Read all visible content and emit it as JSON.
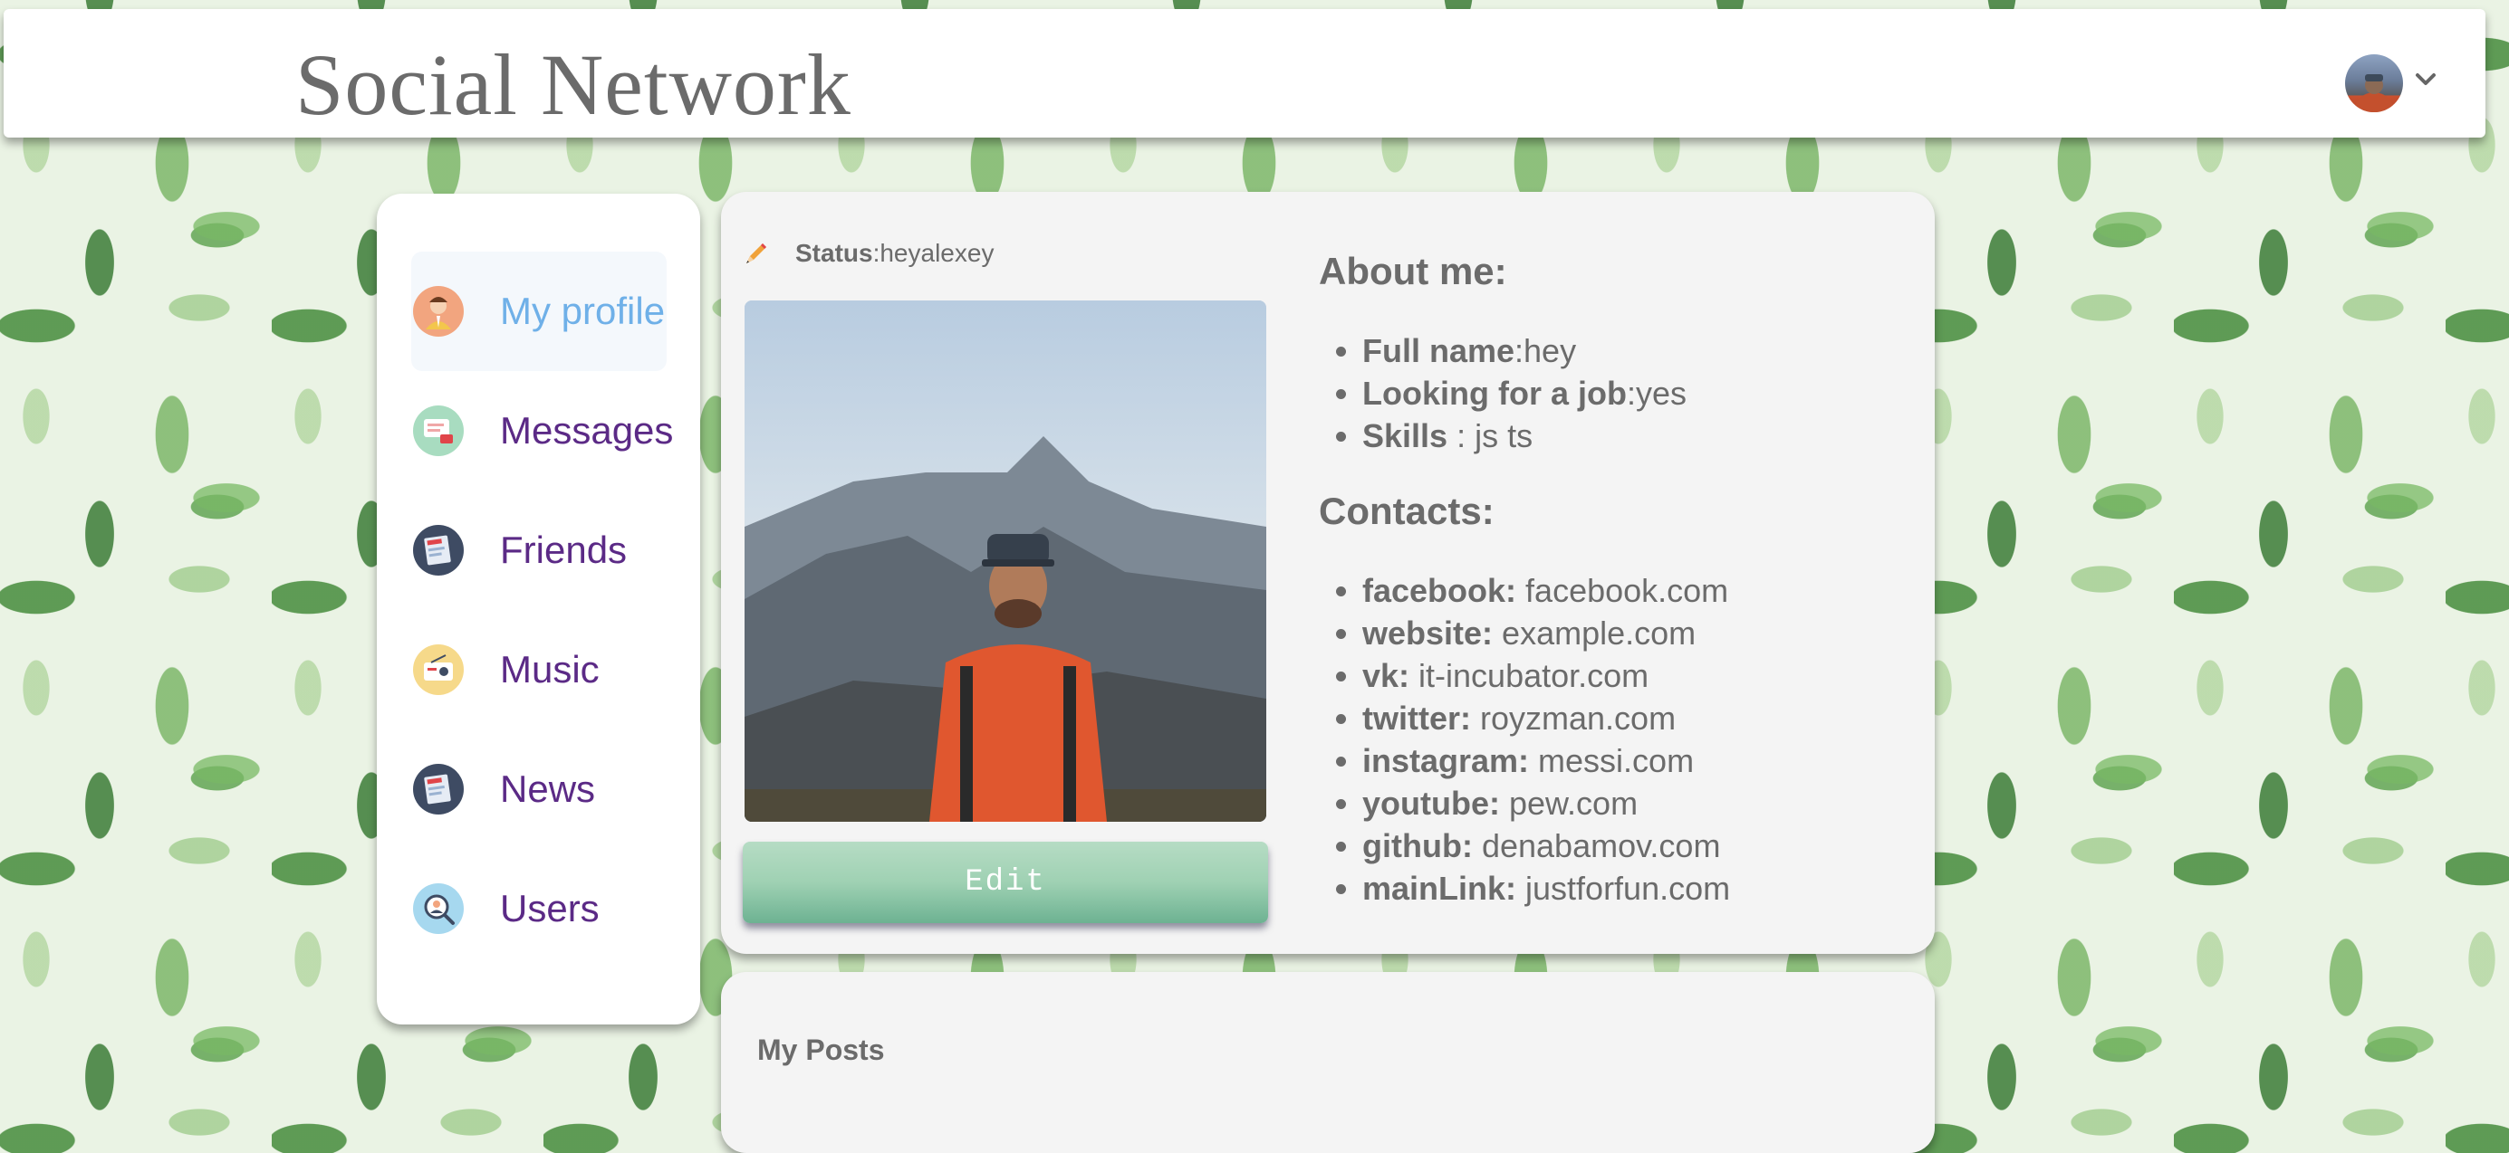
{
  "header": {
    "title": "Social Network",
    "avatar_icon": "user-avatar",
    "chevron_icon": "chevron-down-icon"
  },
  "sidebar": {
    "items": [
      {
        "label": "My profile",
        "icon": "profile-icon",
        "active": true
      },
      {
        "label": "Messages",
        "icon": "messages-icon",
        "active": false
      },
      {
        "label": "Friends",
        "icon": "friends-icon",
        "active": false
      },
      {
        "label": "Music",
        "icon": "music-icon",
        "active": false
      },
      {
        "label": "News",
        "icon": "news-icon",
        "active": false
      },
      {
        "label": "Users",
        "icon": "users-icon",
        "active": false
      }
    ]
  },
  "profile": {
    "status_label": "Status",
    "status_value": ":heyalexey",
    "edit_label": "Edit",
    "about_title": "About me:",
    "about": [
      {
        "key": "Full name",
        "value": ":hey"
      },
      {
        "key": "Looking for a job",
        "value": ":yes"
      },
      {
        "key": "Skills ",
        "value": ": js ts"
      }
    ],
    "contacts_title": "Contacts:",
    "contacts": [
      {
        "key": "facebook:",
        "value": " facebook.com"
      },
      {
        "key": "website:",
        "value": " example.com"
      },
      {
        "key": "vk:",
        "value": " it-incubator.com"
      },
      {
        "key": "twitter:",
        "value": " royzman.com"
      },
      {
        "key": "instagram:",
        "value": " messi.com"
      },
      {
        "key": "youtube:",
        "value": " pew.com"
      },
      {
        "key": "github:",
        "value": " denabamov.com"
      },
      {
        "key": "mainLink:",
        "value": " justforfun.com"
      }
    ]
  },
  "posts": {
    "title": "My Posts"
  },
  "colors": {
    "accent_active": "#6fb0e8",
    "nav_text": "#5b2a86",
    "edit_button": "#9fd1b3",
    "text_gray": "#6b6b6b"
  }
}
